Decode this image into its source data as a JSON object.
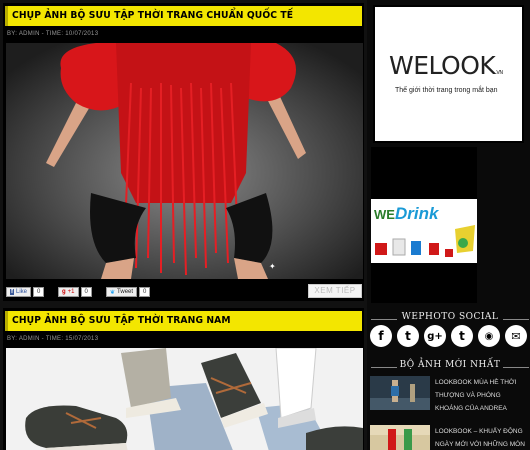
{
  "posts": [
    {
      "title": "CHỤP ẢNH BỘ SƯU TẬP THỜI TRANG CHUẨN QUỐC TẾ",
      "meta": "BY: ADMIN - TIME: 10/07/2013",
      "share": {
        "fb_label": "Like",
        "fb_count": "0",
        "gplus_label": "+1",
        "gplus_count": "0",
        "tweet_label": "Tweet",
        "tweet_count": "0"
      },
      "read_more": "XEM TIẾP"
    },
    {
      "title": "CHỤP ẢNH BỘ SƯU TẬP THỜI TRANG NAM",
      "meta": "BY: ADMIN - TIME: 15/07/2013"
    }
  ],
  "sidebar": {
    "welook": {
      "logo": "WELOOK",
      "logo_suffix": ".VN",
      "tagline": "Thế giới thời trang trong mắt bạn"
    },
    "wedrink": {
      "logo_we": "WE",
      "logo_drink": "Drink"
    },
    "social_title": "WEPHOTO SOCIAL",
    "social": [
      {
        "icon": "facebook-icon",
        "glyph": "f"
      },
      {
        "icon": "twitter-icon",
        "glyph": "t"
      },
      {
        "icon": "gplus-icon",
        "glyph": "g+"
      },
      {
        "icon": "tumblr-icon",
        "glyph": "t"
      },
      {
        "icon": "rss-icon",
        "glyph": "◉"
      },
      {
        "icon": "mail-icon",
        "glyph": "✉"
      }
    ],
    "recent_title": "BỘ ẢNH MỚI NHẤT",
    "recent": [
      {
        "text": "LOOKBOOK MÙA HÈ THỜI THƯỢNG VÀ PHÓNG KHOÁNG CỦA ANDREA"
      },
      {
        "text": "LOOKBOOK – KHUẤY ĐỘNG NGÀY MỚI VỚI NHỮNG MÓN"
      }
    ]
  },
  "colors": {
    "title_bar": "#f3e600",
    "background": "#0a0a0a",
    "accent_blue": "#1a9ad6"
  }
}
